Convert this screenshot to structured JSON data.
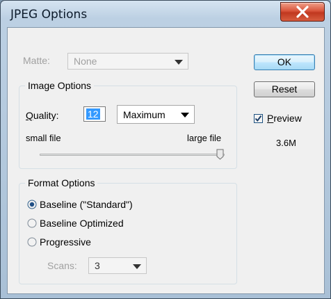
{
  "window": {
    "title": "JPEG Options",
    "close_label": "X"
  },
  "matte": {
    "label": "Matte:",
    "value": "None"
  },
  "image_options": {
    "legend": "Image Options",
    "quality_label": "Quality:",
    "quality_value": "12",
    "quality_preset": "Maximum",
    "small_label": "small file",
    "large_label": "large file",
    "quality_fraction": 1.0
  },
  "format_options": {
    "legend": "Format Options",
    "options": [
      {
        "label": "Baseline (\"Standard\")",
        "selected": true
      },
      {
        "label": "Baseline Optimized",
        "selected": false
      },
      {
        "label": "Progressive",
        "selected": false
      }
    ],
    "scans_label": "Scans:",
    "scans_value": "3"
  },
  "buttons": {
    "ok": "OK",
    "reset": "Reset"
  },
  "preview": {
    "label": "Preview",
    "checked": true,
    "size": "3.6M"
  },
  "colors": {
    "selection": "#3399ff",
    "close_red": "#c0381f",
    "disabled": "#a0a0a0"
  }
}
